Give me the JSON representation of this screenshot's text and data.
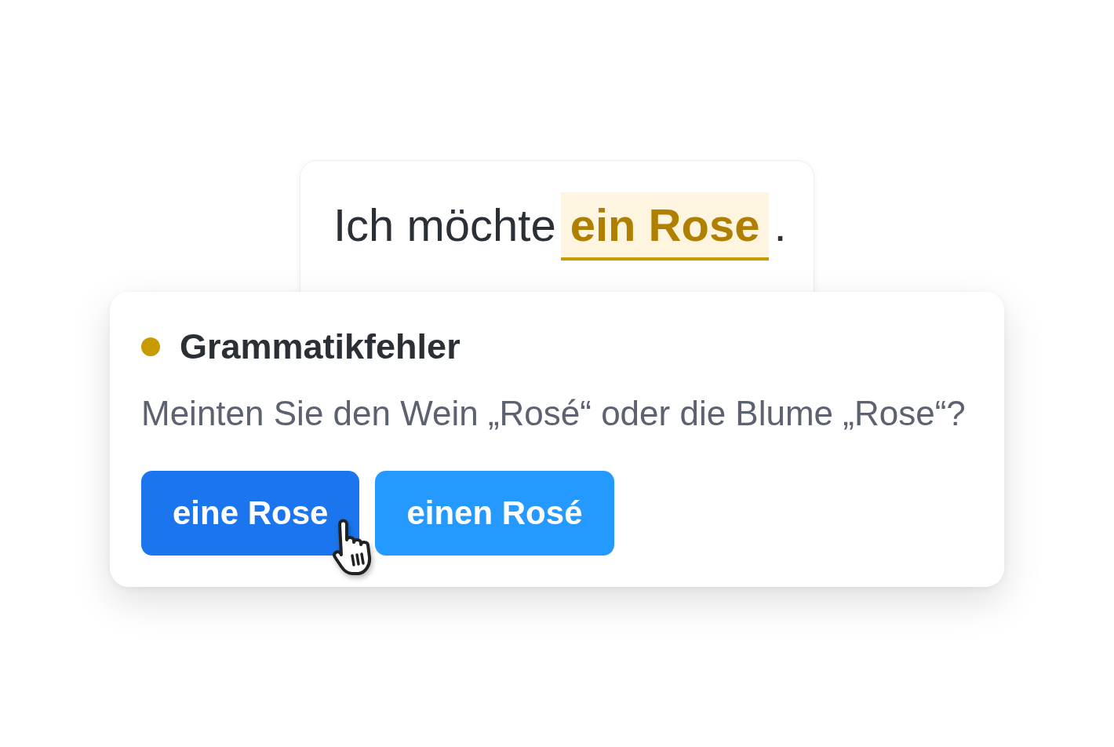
{
  "editor": {
    "text_before": "Ich möchte",
    "flagged_text": "ein Rose",
    "text_after": "."
  },
  "suggestion_card": {
    "issue": {
      "title": "Grammatikfehler",
      "color": "#c89b00"
    },
    "message": "Meinten Sie den Wein „Rosé“ oder die Blume „Rose“?",
    "suggestions": [
      {
        "label": "eine Rose",
        "hovered": true
      },
      {
        "label": "einen Rosé",
        "hovered": false
      }
    ]
  }
}
